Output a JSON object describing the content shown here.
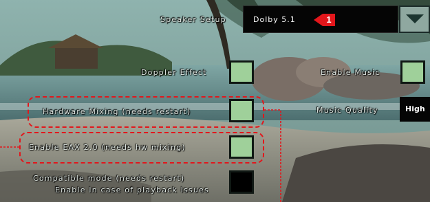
{
  "speaker_setup": {
    "label": "Speaker Setup",
    "value": "Dolby 5.1"
  },
  "annotation": {
    "badge_number": "1",
    "accent": "#e3161b"
  },
  "options": {
    "doppler_effect": {
      "label": "Doppler Effect",
      "checked": true
    },
    "hardware_mixing": {
      "label": "Hardware Mixing (needs restart)",
      "checked": true
    },
    "enable_eax": {
      "label": "Enable EAX 2.0 (needs hw mixing)",
      "checked": true
    },
    "compatible_mode": {
      "label_line1": "Compatible mode (needs restart)",
      "label_line2": "Enable in case of playback issues",
      "checked": false
    },
    "enable_music": {
      "label": "Enable Music",
      "checked": true
    },
    "music_quality": {
      "label": "Music Quality",
      "value": "High"
    }
  },
  "colors": {
    "checked_fill": "#9fd09a",
    "unchecked_fill": "#000000",
    "field_bg": "#050505"
  }
}
